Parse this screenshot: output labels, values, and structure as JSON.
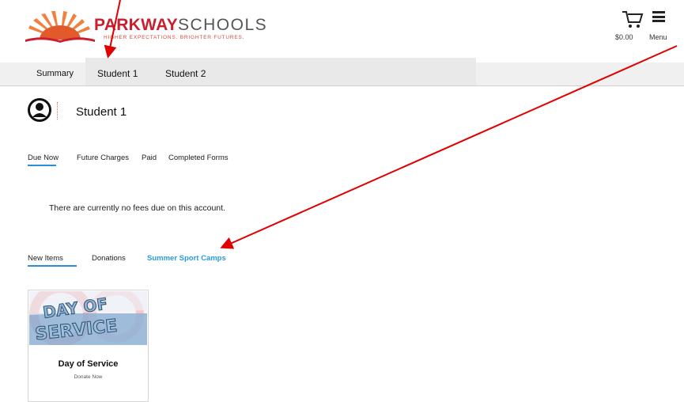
{
  "header": {
    "brand_bold": "PARKWAY",
    "brand_light": "SCHOOLS",
    "tagline": "HIGHER EXPECTATIONS. BRIGHTER FUTURES.",
    "cart_amount": "$0.00",
    "menu_label": "Menu"
  },
  "tabs": [
    {
      "label": "Summary"
    },
    {
      "label": "Student 1"
    },
    {
      "label": "Student 2"
    }
  ],
  "student": {
    "name": "Student 1"
  },
  "fee_tabs": [
    {
      "label": "Due Now",
      "active": true
    },
    {
      "label": "Future Charges"
    },
    {
      "label": "Paid"
    },
    {
      "label": "Completed Forms"
    }
  ],
  "fees_message": "There are currently no fees due on this account.",
  "item_tabs": [
    {
      "label": "New Items",
      "active": true
    },
    {
      "label": "Donations"
    },
    {
      "label": "Summer Sport Camps",
      "highlight": true
    }
  ],
  "card": {
    "image_text_line1": "DAY OF",
    "image_text_line2": "SERVICE",
    "title": "Day of Service",
    "subtitle": "Donate Now"
  },
  "colors": {
    "brand_red": "#c8202e",
    "link_blue": "#2a9be0",
    "annotation_red": "#e00000"
  }
}
